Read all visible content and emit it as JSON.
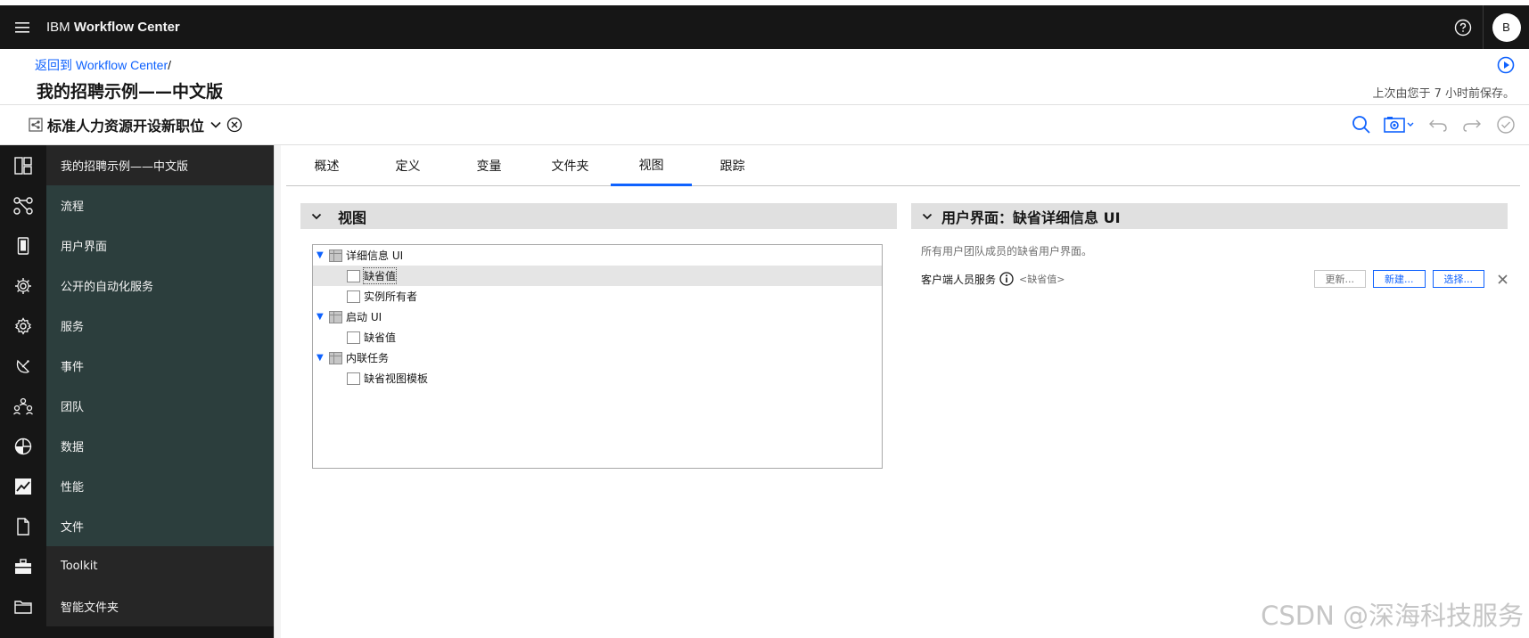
{
  "app": {
    "brand_prefix": "IBM",
    "brand_name": "Workflow Center",
    "avatar_initial": "B"
  },
  "header": {
    "breadcrumb_link": "返回到 Workflow Center",
    "breadcrumb_sep": "/",
    "page_title": "我的招聘示例——中文版",
    "saved_text": "上次由您于 7 小时前保存。"
  },
  "process": {
    "name": "标准人力资源开设新职位"
  },
  "sidebar": {
    "items": [
      {
        "label": "我的招聘示例——中文版",
        "icon": "dashboard-icon"
      },
      {
        "label": "流程",
        "icon": "process-icon"
      },
      {
        "label": "用户界面",
        "icon": "mobile-icon"
      },
      {
        "label": "公开的自动化服务",
        "icon": "automation-service-icon"
      },
      {
        "label": "服务",
        "icon": "settings-icon"
      },
      {
        "label": "事件",
        "icon": "satellite-icon"
      },
      {
        "label": "团队",
        "icon": "team-icon"
      },
      {
        "label": "数据",
        "icon": "pie-chart-icon"
      },
      {
        "label": "性能",
        "icon": "chart-icon"
      },
      {
        "label": "文件",
        "icon": "document-icon"
      },
      {
        "label": "Toolkit",
        "icon": "toolkit-icon"
      },
      {
        "label": "智能文件夹",
        "icon": "folder-icon"
      }
    ]
  },
  "tabs": [
    "概述",
    "定义",
    "变量",
    "文件夹",
    "视图",
    "跟踪"
  ],
  "active_tab": "视图",
  "views_panel": {
    "title": "视图",
    "tree": [
      {
        "label": "详细信息 UI",
        "level": 0
      },
      {
        "label": "缺省值",
        "level": 1,
        "selected": true
      },
      {
        "label": "实例所有者",
        "level": 1
      },
      {
        "label": "启动 UI",
        "level": 0
      },
      {
        "label": "缺省值",
        "level": 1
      },
      {
        "label": "内联任务",
        "level": 0
      },
      {
        "label": "缺省视图模板",
        "level": 1
      }
    ]
  },
  "detail_panel": {
    "title": "用户界面：缺省详细信息 UI",
    "description": "所有用户团队成员的缺省用户界面。",
    "row_name": "客户端人员服务",
    "row_value": "<缺省值>",
    "update_label": "更新...",
    "new_label": "新建...",
    "select_label": "选择..."
  },
  "watermark": "CSDN @深海科技服务",
  "colors": {
    "accent": "#0f62fe",
    "topbar": "#161616",
    "sidebar_teal": "#2c3e3d"
  }
}
